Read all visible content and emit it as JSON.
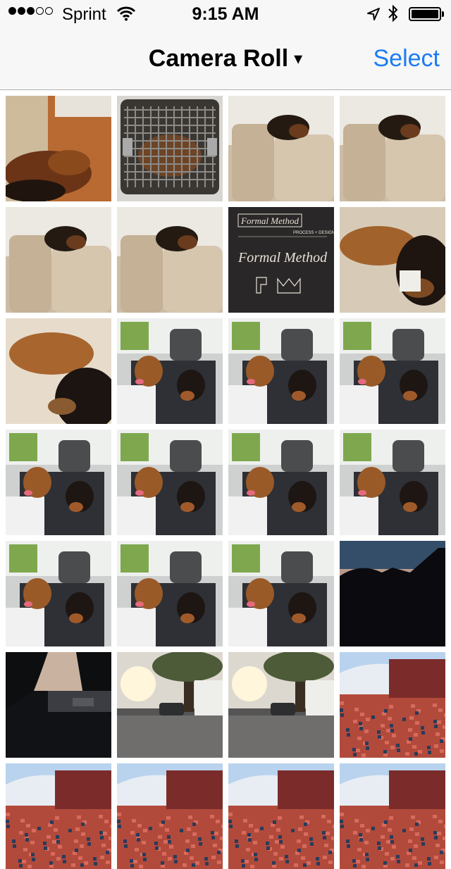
{
  "status_bar": {
    "carrier": "Sprint",
    "time": "9:15 AM",
    "signal_bars_filled": 3,
    "signal_bars_total": 5,
    "icons": [
      "wifi-icon",
      "location-arrow-icon",
      "bluetooth-icon",
      "battery-icon"
    ]
  },
  "nav": {
    "title": "Camera Roll",
    "title_caret": "▾",
    "select_label": "Select",
    "accent_color": "#1a7cf5"
  },
  "photo_grid": {
    "columns": 4,
    "photos": [
      {
        "kind": "dog-on-floor"
      },
      {
        "kind": "dog-crate"
      },
      {
        "kind": "dog-on-couch"
      },
      {
        "kind": "dog-on-couch"
      },
      {
        "kind": "dog-on-couch"
      },
      {
        "kind": "dog-on-couch"
      },
      {
        "kind": "logo-card",
        "text": "Formal Method",
        "subtext": "PROCESS + DESIGN"
      },
      {
        "kind": "dog-on-couch-close"
      },
      {
        "kind": "dog-on-bed"
      },
      {
        "kind": "dogs-in-car"
      },
      {
        "kind": "dogs-in-car"
      },
      {
        "kind": "dogs-in-car"
      },
      {
        "kind": "dogs-in-car"
      },
      {
        "kind": "dogs-in-car"
      },
      {
        "kind": "dogs-in-car"
      },
      {
        "kind": "dogs-in-car"
      },
      {
        "kind": "dogs-in-car"
      },
      {
        "kind": "dogs-in-car"
      },
      {
        "kind": "dogs-in-car"
      },
      {
        "kind": "sunset-silhouette"
      },
      {
        "kind": "street-dusk"
      },
      {
        "kind": "street-sunset"
      },
      {
        "kind": "street-sunset"
      },
      {
        "kind": "stadium"
      },
      {
        "kind": "stadium"
      },
      {
        "kind": "stadium"
      },
      {
        "kind": "stadium"
      },
      {
        "kind": "stadium"
      }
    ]
  }
}
